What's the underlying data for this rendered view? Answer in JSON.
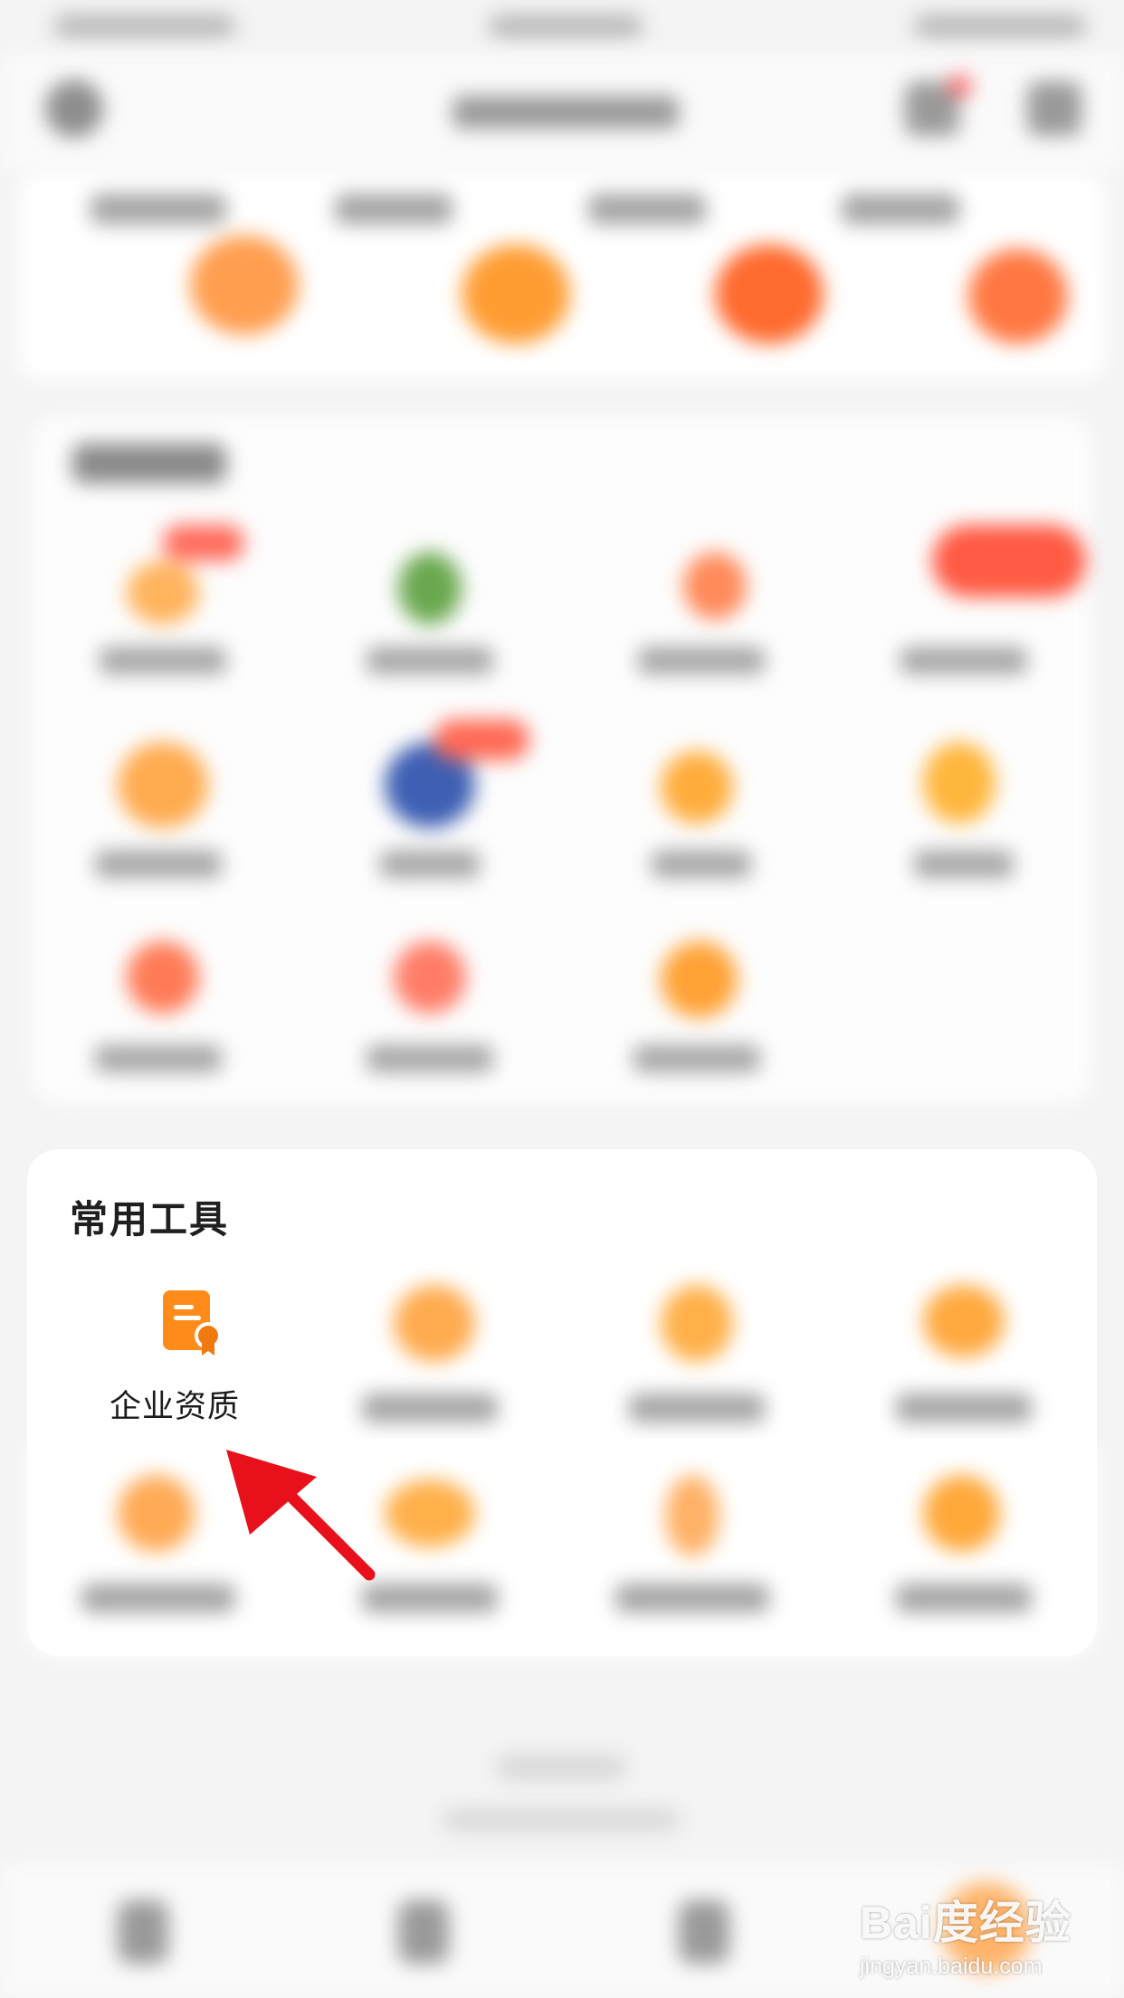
{
  "tools_section": {
    "title": "常用工具",
    "first_tool_label": "企业资质",
    "first_tool_icon": "certificate-document-icon"
  },
  "watermark": {
    "main": "Bai度经验",
    "sub": "jingyan.baidu.com"
  },
  "colors": {
    "accent": "#ff8c1a",
    "icon_dark_orange": "#f07a10",
    "arrow_red": "#e8111b"
  }
}
